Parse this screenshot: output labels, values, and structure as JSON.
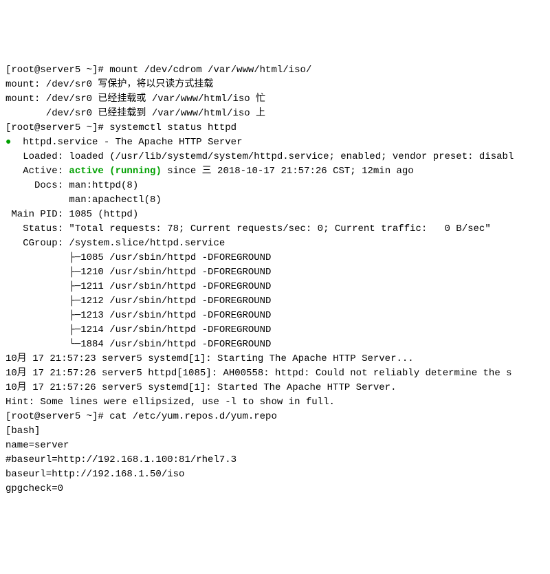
{
  "lines": [
    {
      "text": "[root@server5 ~]# mount /dev/cdrom /var/www/html/iso/"
    },
    {
      "text": "mount: /dev/sr0 写保护，将以只读方式挂载"
    },
    {
      "text": "mount: /dev/sr0 已经挂载或 /var/www/html/iso 忙"
    },
    {
      "text": "       /dev/sr0 已经挂载到 /var/www/html/iso 上"
    },
    {
      "text": "[root@server5 ~]# systemctl status httpd"
    },
    {
      "segments": [
        {
          "text": "●  ",
          "class": "dot"
        },
        {
          "text": "httpd.service - The Apache HTTP Server"
        }
      ]
    },
    {
      "text": "   Loaded: loaded (/usr/lib/systemd/system/httpd.service; enabled; vendor preset: disabl"
    },
    {
      "segments": [
        {
          "text": "   Active: "
        },
        {
          "text": "active (running)",
          "class": "green"
        },
        {
          "text": " since 三 2018-10-17 21:57:26 CST; 12min ago"
        }
      ]
    },
    {
      "text": "     Docs: man:httpd(8)"
    },
    {
      "text": "           man:apachectl(8)"
    },
    {
      "text": " Main PID: 1085 (httpd)"
    },
    {
      "text": "   Status: \"Total requests: 78; Current requests/sec: 0; Current traffic:   0 B/sec\""
    },
    {
      "text": "   CGroup: /system.slice/httpd.service"
    },
    {
      "text": "           ├─1085 /usr/sbin/httpd -DFOREGROUND"
    },
    {
      "text": "           ├─1210 /usr/sbin/httpd -DFOREGROUND"
    },
    {
      "text": "           ├─1211 /usr/sbin/httpd -DFOREGROUND"
    },
    {
      "text": "           ├─1212 /usr/sbin/httpd -DFOREGROUND"
    },
    {
      "text": "           ├─1213 /usr/sbin/httpd -DFOREGROUND"
    },
    {
      "text": "           ├─1214 /usr/sbin/httpd -DFOREGROUND"
    },
    {
      "text": "           └─1884 /usr/sbin/httpd -DFOREGROUND"
    },
    {
      "text": ""
    },
    {
      "text": "10月 17 21:57:23 server5 systemd[1]: Starting The Apache HTTP Server..."
    },
    {
      "text": "10月 17 21:57:26 server5 httpd[1085]: AH00558: httpd: Could not reliably determine the s"
    },
    {
      "text": "10月 17 21:57:26 server5 systemd[1]: Started The Apache HTTP Server."
    },
    {
      "text": "Hint: Some lines were ellipsized, use -l to show in full."
    },
    {
      "text": "[root@server5 ~]# cat /etc/yum.repos.d/yum.repo"
    },
    {
      "text": "[bash]"
    },
    {
      "text": "name=server"
    },
    {
      "text": "#baseurl=http://192.168.1.100:81/rhel7.3"
    },
    {
      "text": "baseurl=http://192.168.1.50/iso"
    },
    {
      "text": "gpgcheck=0"
    }
  ]
}
